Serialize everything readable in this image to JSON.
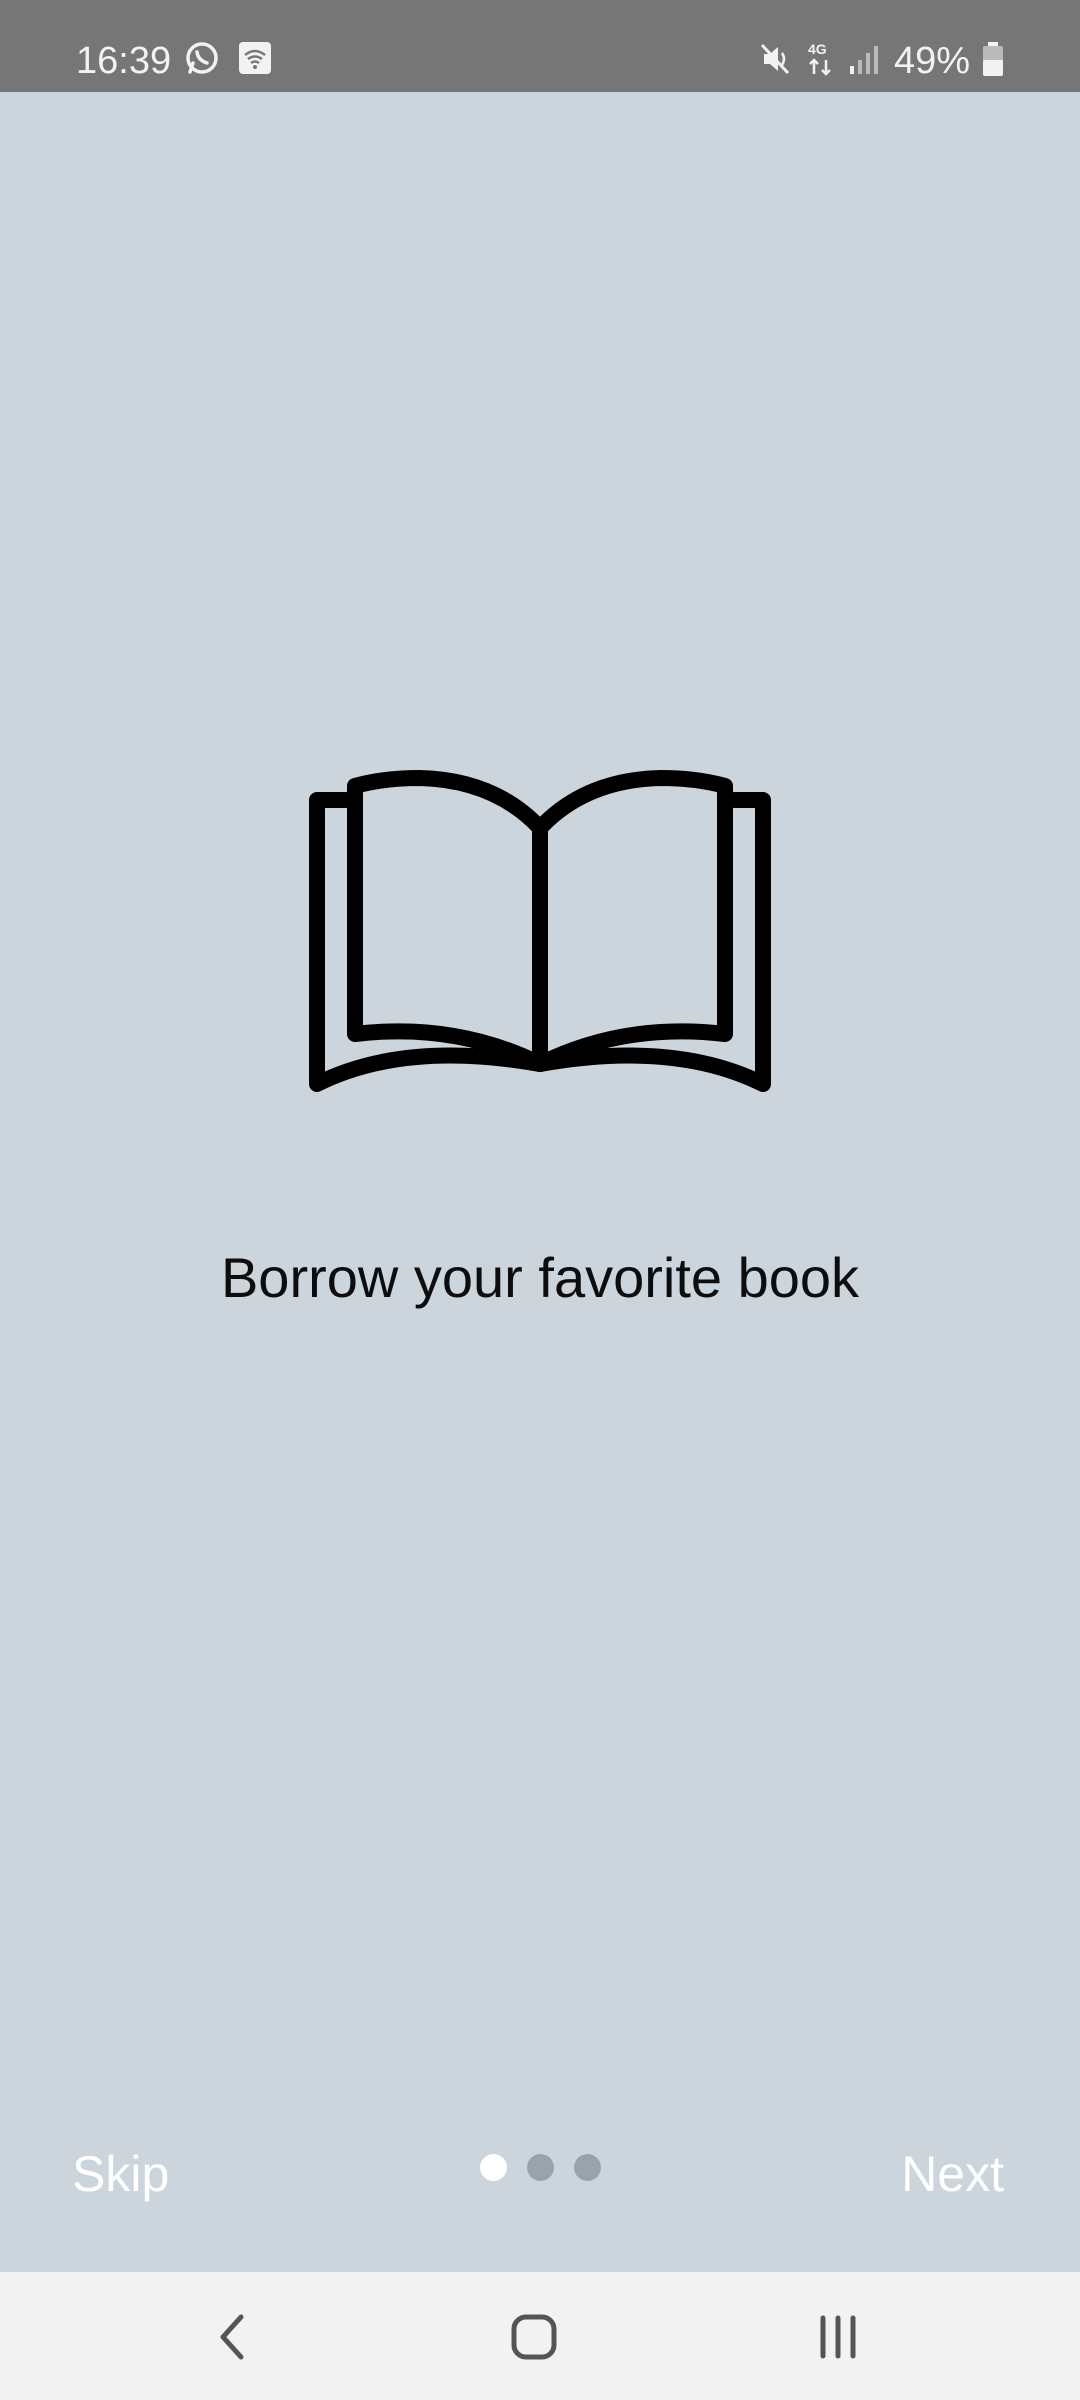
{
  "status_bar": {
    "time": "16:39",
    "battery": "49%",
    "left_icons": [
      "whatsapp-icon",
      "wifi-calling-icon"
    ],
    "right_icons": [
      "mute-icon",
      "4g-icon",
      "signal-icon",
      "battery-icon"
    ]
  },
  "onboarding": {
    "icon": "open-book-icon",
    "title": "Borrow your favorite book",
    "page_indicator": {
      "current": 1,
      "total": 3
    }
  },
  "actions": {
    "skip_label": "Skip",
    "next_label": "Next"
  },
  "nav_bar": {
    "buttons": [
      "back-icon",
      "home-icon",
      "recents-icon"
    ]
  },
  "colors": {
    "background": "#ccd4dc",
    "status_bar": "#767676",
    "nav_bar": "#f2f2f2",
    "text_dark": "#0d0d0d",
    "dot_inactive": "#9aa2ab",
    "dot_active": "#ffffff"
  }
}
